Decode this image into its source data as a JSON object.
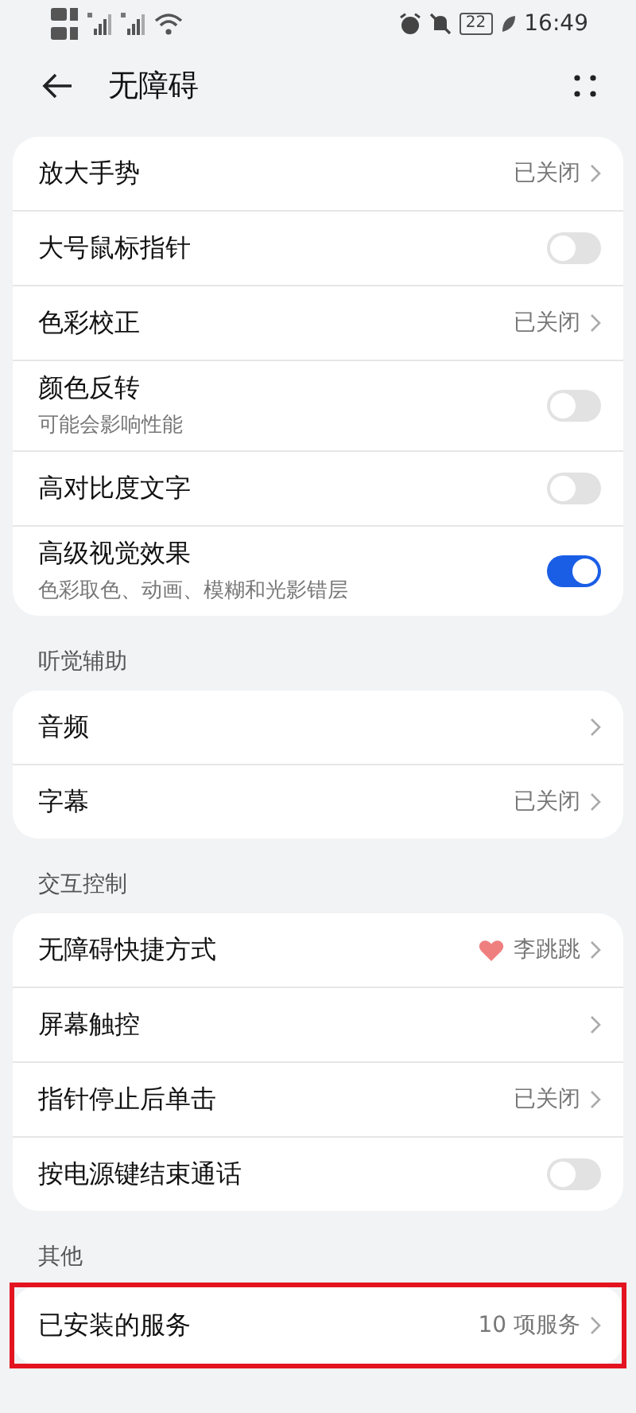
{
  "status_bar": {
    "time": "16:49",
    "battery": "22"
  },
  "header": {
    "title": "无障碍"
  },
  "sections": [
    {
      "items": [
        {
          "kind": "link",
          "label": "放大手势",
          "value": "已关闭"
        },
        {
          "kind": "toggle",
          "label": "大号鼠标指针",
          "on": false
        },
        {
          "kind": "link",
          "label": "色彩校正",
          "value": "已关闭"
        },
        {
          "kind": "toggle",
          "label": "颜色反转",
          "subtitle": "可能会影响性能",
          "on": false
        },
        {
          "kind": "toggle",
          "label": "高对比度文字",
          "on": false
        },
        {
          "kind": "toggle",
          "label": "高级视觉效果",
          "subtitle": "色彩取色、动画、模糊和光影错层",
          "on": true
        }
      ]
    },
    {
      "title": "听觉辅助",
      "items": [
        {
          "kind": "link",
          "label": "音频"
        },
        {
          "kind": "link",
          "label": "字幕",
          "value": "已关闭"
        }
      ]
    },
    {
      "title": "交互控制",
      "items": [
        {
          "kind": "shortcut",
          "label": "无障碍快捷方式",
          "value": "李跳跳"
        },
        {
          "kind": "link",
          "label": "屏幕触控"
        },
        {
          "kind": "link",
          "label": "指针停止后单击",
          "value": "已关闭"
        },
        {
          "kind": "toggle",
          "label": "按电源键结束通话",
          "on": false
        }
      ]
    },
    {
      "title": "其他",
      "items": [
        {
          "kind": "link",
          "label": "已安装的服务",
          "value": "10 项服务",
          "highlighted": true
        }
      ]
    }
  ]
}
